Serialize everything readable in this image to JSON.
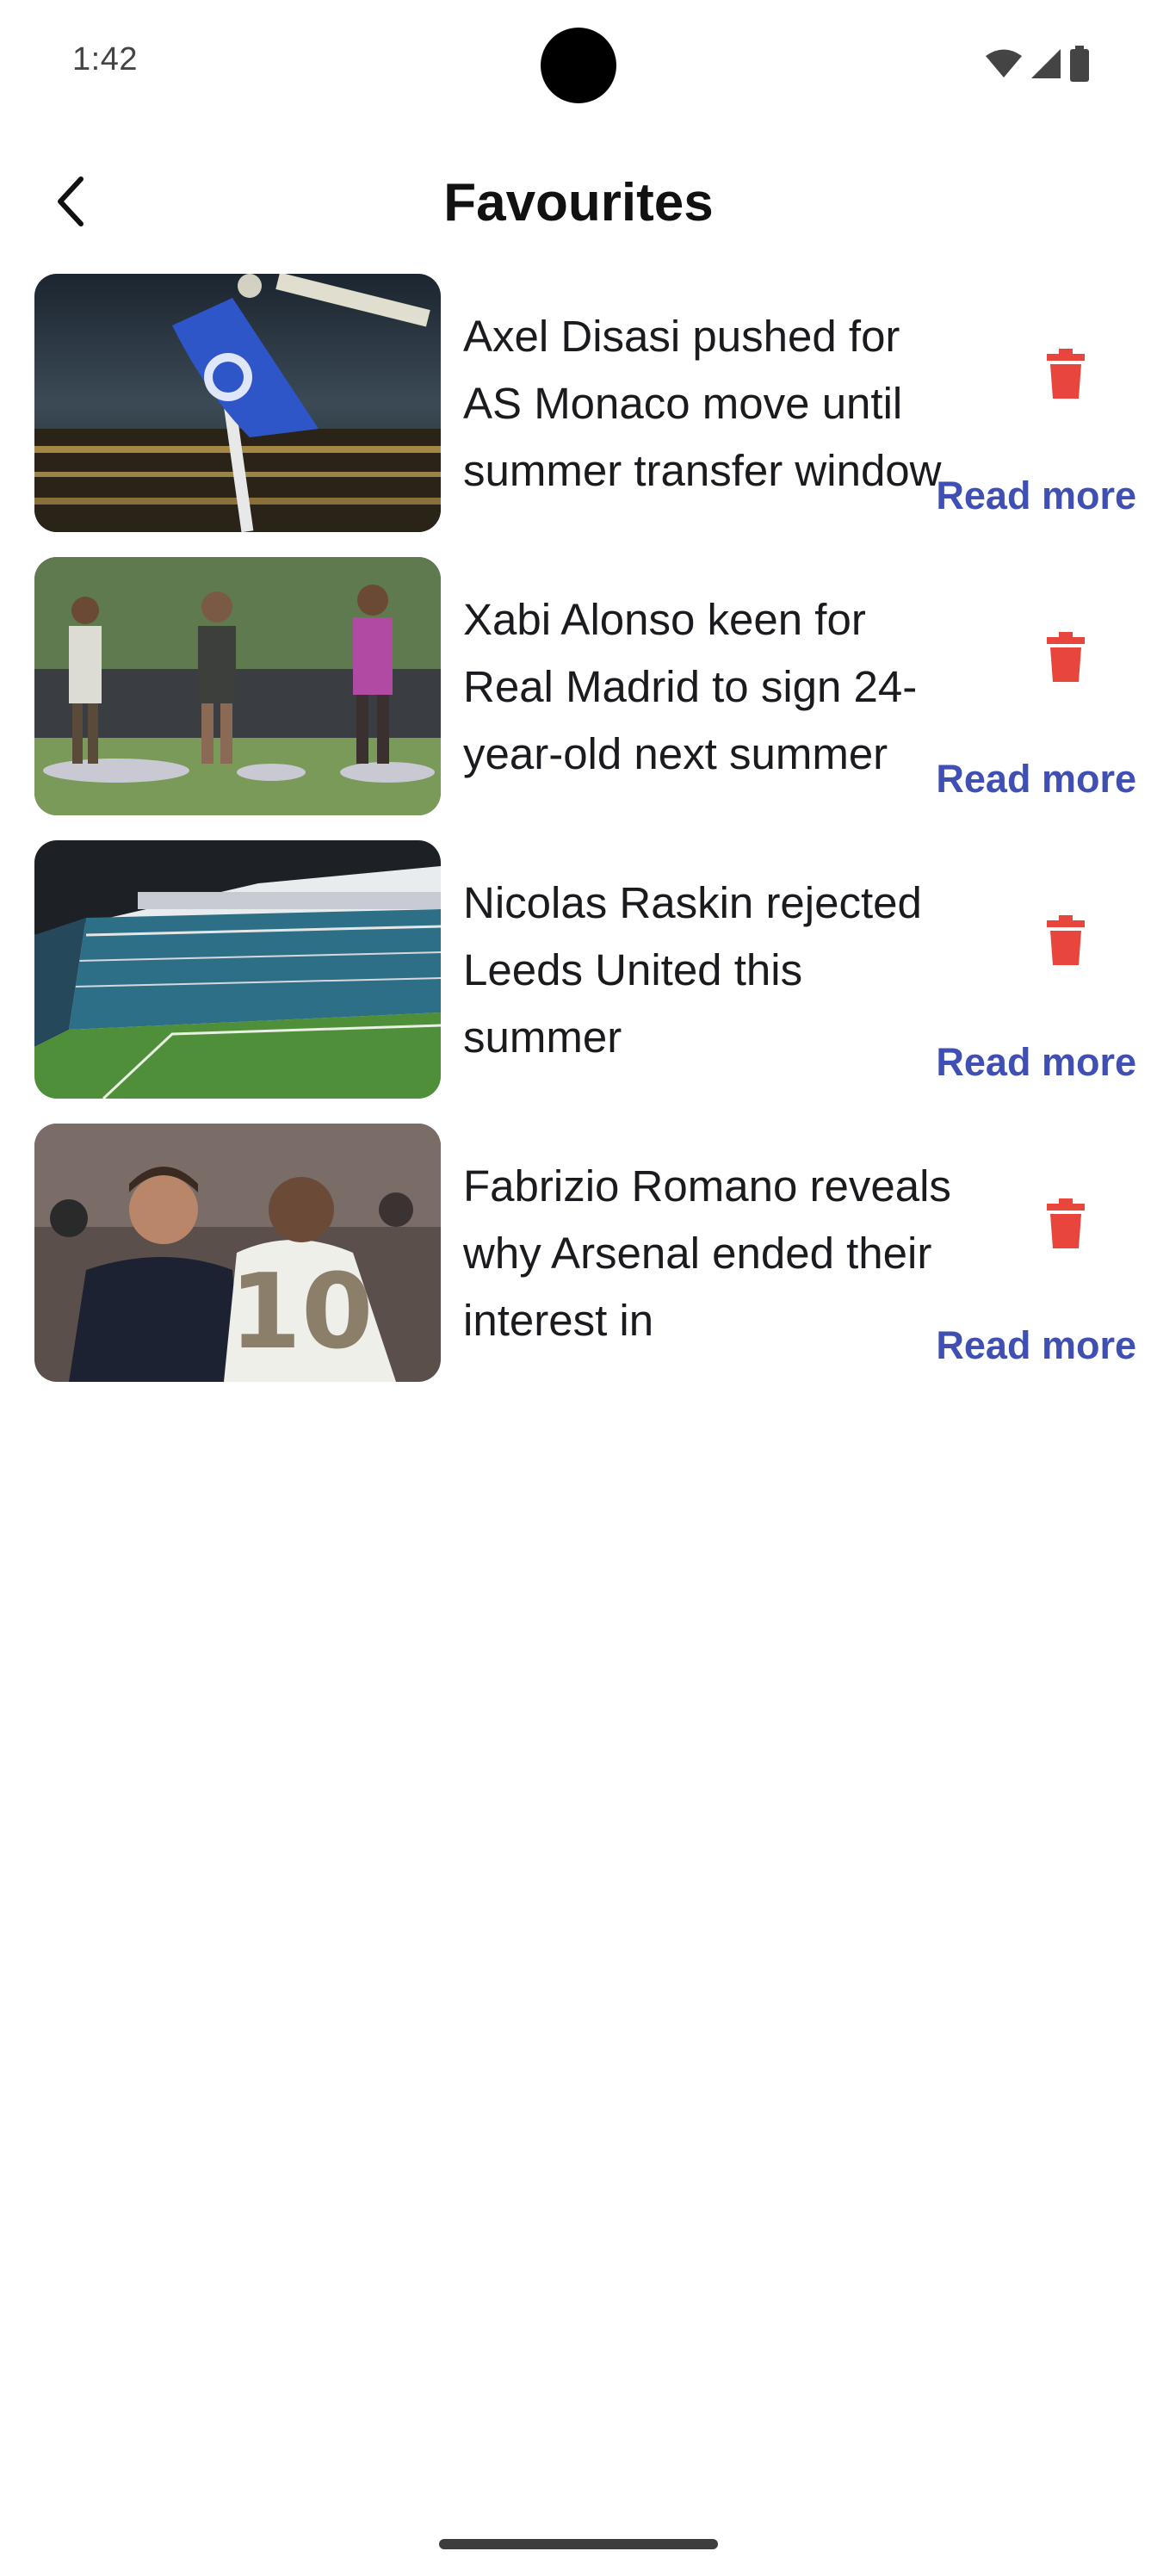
{
  "status_bar": {
    "time": "1:42",
    "icons": [
      "wifi-icon",
      "signal-icon",
      "battery-icon"
    ]
  },
  "app_bar": {
    "back_icon": "chevron-left-icon",
    "title": "Favourites"
  },
  "colors": {
    "delete": "#e8453c",
    "read_more": "#3f4fb4",
    "title_text": "#111111"
  },
  "favourites": [
    {
      "title": "Axel Disasi pushed for AS Monaco move until summer transfer window",
      "image": "chelsea-corner-flag-photo",
      "delete_icon": "trash-icon",
      "read_more_label": "Read more"
    },
    {
      "title": "Xabi Alonso keen for Real Madrid to sign 24-year-old next summer",
      "image": "real-madrid-training-photo",
      "delete_icon": "trash-icon",
      "read_more_label": "Read more"
    },
    {
      "title": "Nicolas Raskin rejected Leeds United this summer",
      "image": "elland-road-stadium-photo",
      "delete_icon": "trash-icon",
      "read_more_label": "Read more"
    },
    {
      "title": "Fabrizio Romano reveals why Arsenal ended their interest in",
      "image": "alonso-mbappe-photo",
      "delete_icon": "trash-icon",
      "read_more_label": "Read more"
    }
  ]
}
